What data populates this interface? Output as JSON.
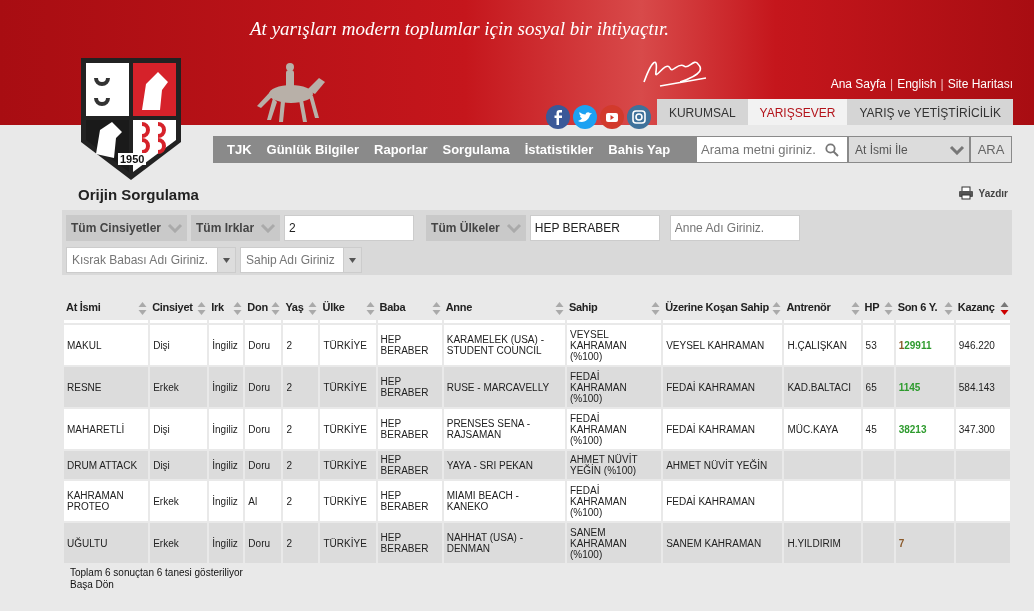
{
  "banner": {
    "slogan": "At yarışları modern toplumlar için sosyal bir ihtiyaçtır."
  },
  "logo": {
    "year": "1950"
  },
  "top_links": [
    {
      "kind": "link",
      "text": "Ana Sayfa"
    },
    {
      "kind": "separator",
      "text": "|"
    },
    {
      "kind": "link",
      "text": "English"
    },
    {
      "kind": "separator",
      "text": "|"
    },
    {
      "kind": "link",
      "text": "Site Haritası"
    }
  ],
  "section_tabs": [
    {
      "label": "KURUMSAL",
      "selected": false
    },
    {
      "label": "YARIŞSEVER",
      "selected": true
    },
    {
      "label": "YARIŞ ve YETİŞTİRİCİLİK",
      "selected": false
    }
  ],
  "nav": [
    "TJK",
    "Günlük Bilgiler",
    "Raporlar",
    "Sorgulama",
    "İstatistikler",
    "Bahis Yap"
  ],
  "search": {
    "placeholder": "Arama metni giriniz.",
    "mode": "At İsmi İle",
    "button": "ARA"
  },
  "page_title": "Orijin Sorgulama",
  "print": "Yazdır",
  "filters": [
    [
      {
        "kind": "select",
        "value": "Tüm Cinsiyetler"
      },
      {
        "kind": "select",
        "value": "Tüm Irklar"
      },
      {
        "kind": "input",
        "value": "2"
      },
      {
        "kind": "select",
        "value": "Tüm Ülkeler"
      },
      {
        "kind": "input",
        "value": "HEP BERABER"
      },
      {
        "kind": "input",
        "placeholder": "Anne Adı Giriniz."
      }
    ],
    [
      {
        "kind": "combo",
        "placeholder": "Kısrak Babası Adı Giriniz."
      },
      {
        "kind": "combo",
        "placeholder": "Sahip Adı Giriniz"
      }
    ]
  ],
  "table": {
    "columns": [
      {
        "label": "At İsmi",
        "sorted": false
      },
      {
        "label": "Cinsiyet",
        "sorted": false
      },
      {
        "label": "Irk",
        "sorted": false
      },
      {
        "label": "Don",
        "sorted": false
      },
      {
        "label": "Yaş",
        "sorted": false
      },
      {
        "label": "Ülke",
        "sorted": false
      },
      {
        "label": "Baba",
        "sorted": false
      },
      {
        "label": "Anne",
        "sorted": false
      },
      {
        "label": "Sahip",
        "sorted": false
      },
      {
        "label": "Üzerine Koşan Sahip",
        "sorted": false
      },
      {
        "label": "Antrenör",
        "sorted": false
      },
      {
        "label": "HP",
        "sorted": false
      },
      {
        "label": "Son 6 Y.",
        "sorted": false
      },
      {
        "label": "Kazanç",
        "sorted": true
      }
    ],
    "rows": [
      {
        "name": "MAKUL",
        "sex": "Dişi",
        "breed": "İngiliz",
        "coat": "Doru",
        "age": "2",
        "country": "TÜRKİYE",
        "sire": "HEP BERABER",
        "dam": "KARAMELEK (USA) - STUDENT COUNCIL",
        "owner": "VEYSEL KAHRAMAN (%100)",
        "runner_owner": "VEYSEL KAHRAMAN",
        "trainer": "H.ÇALIŞKAN",
        "hp": "53",
        "last6": [
          {
            "text": "1",
            "color": "#8b5a2b"
          },
          {
            "text": "29911",
            "color": "#2e9b2e"
          }
        ],
        "earnings": "946.220"
      },
      {
        "name": "RESNE",
        "sex": "Erkek",
        "breed": "İngiliz",
        "coat": "Doru",
        "age": "2",
        "country": "TÜRKİYE",
        "sire": "HEP BERABER",
        "dam": "RUSE - MARCAVELLY",
        "owner": "FEDAİ KAHRAMAN (%100)",
        "runner_owner": "FEDAİ KAHRAMAN",
        "trainer": "KAD.BALTACI",
        "hp": "65",
        "last6": [
          {
            "text": "1145",
            "color": "#2e9b2e"
          }
        ],
        "earnings": "584.143"
      },
      {
        "name": "MAHARETLİ",
        "sex": "Dişi",
        "breed": "İngiliz",
        "coat": "Doru",
        "age": "2",
        "country": "TÜRKİYE",
        "sire": "HEP BERABER",
        "dam": "PRENSES SENA - RAJSAMAN",
        "owner": "FEDAİ KAHRAMAN (%100)",
        "runner_owner": "FEDAİ KAHRAMAN",
        "trainer": "MÜC.KAYA",
        "hp": "45",
        "last6": [
          {
            "text": "38213",
            "color": "#2e9b2e"
          }
        ],
        "earnings": "347.300"
      },
      {
        "name": "DRUM ATTACK",
        "sex": "Dişi",
        "breed": "İngiliz",
        "coat": "Doru",
        "age": "2",
        "country": "TÜRKİYE",
        "sire": "HEP BERABER",
        "dam": "YAYA - SRI PEKAN",
        "owner": "AHMET NÜVİT YEĞİN (%100)",
        "runner_owner": "AHMET NÜVİT YEĞİN"
      },
      {
        "name": "KAHRAMAN PROTEO",
        "sex": "Erkek",
        "breed": "İngiliz",
        "coat": "Al",
        "age": "2",
        "country": "TÜRKİYE",
        "sire": "HEP BERABER",
        "dam": "MIAMI BEACH - KANEKO",
        "owner": "FEDAİ KAHRAMAN (%100)",
        "runner_owner": "FEDAİ KAHRAMAN"
      },
      {
        "name": "UĞULTU",
        "sex": "Erkek",
        "breed": "İngiliz",
        "coat": "Doru",
        "age": "2",
        "country": "TÜRKİYE",
        "sire": "HEP BERABER",
        "dam": "NAHHAT (USA) - DENMAN",
        "owner": "SANEM KAHRAMAN (%100)",
        "runner_owner": "SANEM KAHRAMAN",
        "trainer": "H.YILDIRIM",
        "last6": [
          {
            "text": "7",
            "color": "#8b5a2b"
          }
        ]
      }
    ]
  },
  "summary": "Toplam 6 sonuçtan 6 tanesi gösteriliyor",
  "back_link": "Başa Dön"
}
